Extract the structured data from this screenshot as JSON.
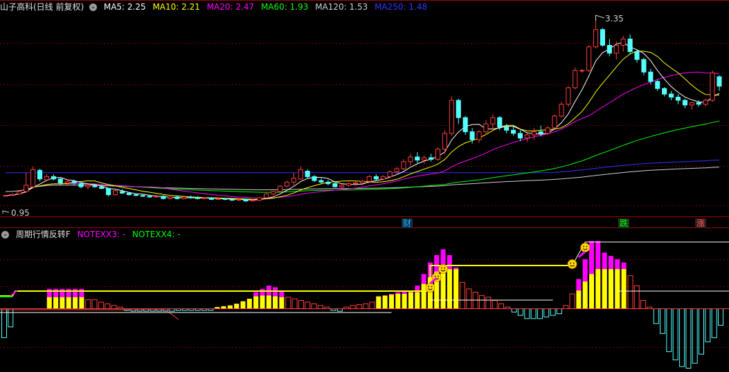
{
  "main_legend": {
    "title": "山子高科(日线 前复权)",
    "items": [
      {
        "label": "MA5: 2.25",
        "color": "#ffffff"
      },
      {
        "label": "MA10: 2.21",
        "color": "#ffff00"
      },
      {
        "label": "MA20: 2.47",
        "color": "#ff00ff"
      },
      {
        "label": "MA60: 1.93",
        "color": "#00ff00"
      },
      {
        "label": "MA120: 1.53",
        "color": "#d0d0d0"
      },
      {
        "label": "MA250: 1.48",
        "color": "#3333ff"
      }
    ]
  },
  "price_labels": {
    "high": "3.35",
    "low": "0.95"
  },
  "event_markers": [
    {
      "label": "财",
      "color": "#00c0ff"
    },
    {
      "label": "跌",
      "color": "#00ff00"
    },
    {
      "label": "涨",
      "color": "#ff6060"
    }
  ],
  "sub_legend": {
    "title": "周期行情反转F",
    "items": [
      {
        "label": "NOTEXX3: -",
        "color": "#ff00ff"
      },
      {
        "label": "NOTEXX4: -",
        "color": "#00ff00"
      }
    ]
  },
  "colors": {
    "up": "#ff3c3c",
    "down": "#54ffff",
    "grid": "#7a0000",
    "magenta_bar": "#ff00ff",
    "yellow_bar": "#ffff00",
    "cyan_bar": "#54ffff",
    "red_bar": "#ff3c3c"
  },
  "chart_data": {
    "type": "candlestick",
    "price_range": [
      0.85,
      3.4
    ],
    "candles": [
      [
        1.09,
        1.1,
        1.08,
        1.09
      ],
      [
        1.1,
        1.12,
        1.09,
        1.1
      ],
      [
        1.11,
        1.15,
        1.1,
        1.14
      ],
      [
        1.14,
        1.38,
        1.12,
        1.22
      ],
      [
        1.2,
        1.46,
        1.18,
        1.42
      ],
      [
        1.41,
        1.43,
        1.27,
        1.3
      ],
      [
        1.29,
        1.36,
        1.27,
        1.33
      ],
      [
        1.33,
        1.36,
        1.28,
        1.3
      ],
      [
        1.3,
        1.31,
        1.22,
        1.25
      ],
      [
        1.25,
        1.29,
        1.21,
        1.27
      ],
      [
        1.27,
        1.29,
        1.23,
        1.25
      ],
      [
        1.24,
        1.26,
        1.18,
        1.2
      ],
      [
        1.2,
        1.23,
        1.17,
        1.22
      ],
      [
        1.21,
        1.24,
        1.19,
        1.2
      ],
      [
        1.2,
        1.22,
        1.17,
        1.18
      ],
      [
        1.18,
        1.19,
        1.08,
        1.1
      ],
      [
        1.1,
        1.16,
        1.09,
        1.15
      ],
      [
        1.14,
        1.17,
        1.11,
        1.12
      ],
      [
        1.12,
        1.13,
        1.09,
        1.1
      ],
      [
        1.1,
        1.12,
        1.08,
        1.09
      ],
      [
        1.09,
        1.11,
        1.07,
        1.08
      ],
      [
        1.08,
        1.1,
        1.06,
        1.07
      ],
      [
        1.07,
        1.1,
        1.06,
        1.08
      ],
      [
        1.08,
        1.09,
        1.04,
        1.05
      ],
      [
        1.05,
        1.08,
        1.04,
        1.07
      ],
      [
        1.07,
        1.09,
        1.04,
        1.05
      ],
      [
        1.05,
        1.08,
        1.04,
        1.07
      ],
      [
        1.07,
        1.09,
        1.05,
        1.06
      ],
      [
        1.06,
        1.08,
        1.04,
        1.05
      ],
      [
        1.05,
        1.07,
        1.04,
        1.06
      ],
      [
        1.06,
        1.07,
        1.03,
        1.04
      ],
      [
        1.04,
        1.06,
        1.03,
        1.05
      ],
      [
        1.05,
        1.06,
        1.03,
        1.04
      ],
      [
        1.04,
        1.05,
        1.02,
        1.03
      ],
      [
        1.03,
        1.05,
        1.02,
        1.04
      ],
      [
        1.04,
        1.05,
        1.01,
        1.02
      ],
      [
        1.02,
        1.04,
        1.01,
        1.03
      ],
      [
        1.03,
        1.07,
        1.02,
        1.06
      ],
      [
        1.06,
        1.12,
        1.05,
        1.11
      ],
      [
        1.11,
        1.15,
        1.09,
        1.14
      ],
      [
        1.14,
        1.22,
        1.13,
        1.21
      ],
      [
        1.21,
        1.28,
        1.19,
        1.26
      ],
      [
        1.26,
        1.38,
        1.22,
        1.31
      ],
      [
        1.3,
        1.46,
        1.29,
        1.42
      ],
      [
        1.4,
        1.42,
        1.3,
        1.33
      ],
      [
        1.33,
        1.35,
        1.26,
        1.28
      ],
      [
        1.28,
        1.31,
        1.24,
        1.26
      ],
      [
        1.26,
        1.29,
        1.22,
        1.24
      ],
      [
        1.24,
        1.27,
        1.19,
        1.2
      ],
      [
        1.2,
        1.24,
        1.17,
        1.22
      ],
      [
        1.22,
        1.26,
        1.2,
        1.24
      ],
      [
        1.24,
        1.28,
        1.21,
        1.25
      ],
      [
        1.25,
        1.29,
        1.22,
        1.27
      ],
      [
        1.27,
        1.35,
        1.25,
        1.33
      ],
      [
        1.33,
        1.36,
        1.28,
        1.3
      ],
      [
        1.3,
        1.35,
        1.28,
        1.33
      ],
      [
        1.33,
        1.41,
        1.31,
        1.39
      ],
      [
        1.39,
        1.45,
        1.35,
        1.43
      ],
      [
        1.43,
        1.55,
        1.41,
        1.52
      ],
      [
        1.52,
        1.62,
        1.47,
        1.58
      ],
      [
        1.58,
        1.64,
        1.5,
        1.54
      ],
      [
        1.54,
        1.6,
        1.49,
        1.57
      ],
      [
        1.57,
        1.62,
        1.52,
        1.55
      ],
      [
        1.55,
        1.7,
        1.53,
        1.68
      ],
      [
        1.68,
        1.92,
        1.62,
        1.88
      ],
      [
        1.88,
        2.35,
        1.85,
        2.3
      ],
      [
        2.3,
        2.32,
        2.0,
        2.08
      ],
      [
        2.08,
        2.1,
        1.86,
        1.9
      ],
      [
        1.9,
        1.95,
        1.75,
        1.8
      ],
      [
        1.8,
        1.92,
        1.76,
        1.9
      ],
      [
        1.9,
        2.05,
        1.86,
        2.0
      ],
      [
        2.0,
        2.12,
        1.92,
        2.08
      ],
      [
        2.08,
        2.1,
        1.92,
        1.96
      ],
      [
        1.96,
        2.0,
        1.88,
        1.92
      ],
      [
        1.92,
        1.98,
        1.85,
        1.88
      ],
      [
        1.88,
        1.92,
        1.78,
        1.82
      ],
      [
        1.82,
        1.88,
        1.77,
        1.86
      ],
      [
        1.86,
        1.95,
        1.8,
        1.9
      ],
      [
        1.9,
        1.98,
        1.84,
        1.88
      ],
      [
        1.88,
        1.97,
        1.86,
        1.95
      ],
      [
        1.95,
        2.12,
        1.94,
        2.1
      ],
      [
        2.1,
        2.28,
        2.08,
        2.25
      ],
      [
        2.25,
        2.48,
        2.22,
        2.46
      ],
      [
        2.46,
        2.72,
        2.44,
        2.68
      ],
      [
        2.68,
        2.7,
        2.65,
        2.68
      ],
      [
        2.68,
        3.0,
        2.66,
        2.98
      ],
      [
        2.98,
        3.35,
        2.96,
        3.2
      ],
      [
        3.2,
        3.22,
        2.98,
        3.0
      ],
      [
        3.0,
        3.08,
        2.86,
        2.9
      ],
      [
        2.9,
        3.05,
        2.82,
        3.0
      ],
      [
        3.0,
        3.12,
        2.92,
        3.08
      ],
      [
        3.08,
        3.14,
        2.88,
        2.92
      ],
      [
        2.92,
        2.94,
        2.78,
        2.82
      ],
      [
        2.82,
        2.84,
        2.62,
        2.66
      ],
      [
        2.66,
        2.7,
        2.5,
        2.54
      ],
      [
        2.54,
        2.56,
        2.42,
        2.45
      ],
      [
        2.45,
        2.47,
        2.35,
        2.38
      ],
      [
        2.38,
        2.42,
        2.3,
        2.34
      ],
      [
        2.34,
        2.38,
        2.25,
        2.3
      ],
      [
        2.3,
        2.32,
        2.2,
        2.24
      ],
      [
        2.24,
        2.28,
        2.18,
        2.27
      ],
      [
        2.27,
        2.3,
        2.22,
        2.25
      ],
      [
        2.25,
        2.32,
        2.22,
        2.3
      ],
      [
        2.3,
        2.68,
        2.28,
        2.65
      ],
      [
        2.6,
        2.62,
        2.42,
        2.48
      ]
    ],
    "indicator": {
      "range": [
        -75,
        85
      ],
      "bars": [
        [
          -35,
          0,
          0
        ],
        [
          -22,
          0,
          0
        ],
        [
          0,
          0,
          0
        ],
        [
          0,
          0,
          0
        ],
        [
          0,
          0,
          0
        ],
        [
          0,
          0,
          0
        ],
        [
          0,
          0,
          0
        ],
        [
          14,
          14,
          24
        ],
        [
          14,
          14,
          24
        ],
        [
          14,
          14,
          24
        ],
        [
          14,
          14,
          24
        ],
        [
          14,
          14,
          24
        ],
        [
          14,
          14,
          24
        ],
        [
          11,
          0,
          0
        ],
        [
          11,
          0,
          0
        ],
        [
          8,
          0,
          0
        ],
        [
          6,
          0,
          0
        ],
        [
          4,
          0,
          0
        ],
        [
          2,
          0,
          0
        ],
        [
          -2,
          0,
          0
        ],
        [
          -3,
          0,
          0
        ],
        [
          -3,
          0,
          0
        ],
        [
          -3,
          0,
          0
        ],
        [
          -3,
          0,
          0
        ],
        [
          -3,
          0,
          0
        ],
        [
          -3,
          0,
          0
        ],
        [
          -3,
          0,
          0
        ],
        [
          -2,
          0,
          0
        ],
        [
          -2,
          0,
          0
        ],
        [
          -2,
          0,
          0
        ],
        [
          -2,
          0,
          0
        ],
        [
          -2,
          0,
          0
        ],
        [
          -2,
          0,
          0
        ],
        [
          2,
          2,
          2
        ],
        [
          3,
          3,
          3
        ],
        [
          4,
          4,
          4
        ],
        [
          6,
          6,
          6
        ],
        [
          9,
          9,
          9
        ],
        [
          12,
          12,
          12
        ],
        [
          15,
          15,
          20
        ],
        [
          16,
          16,
          24
        ],
        [
          16,
          16,
          28
        ],
        [
          15,
          15,
          26
        ],
        [
          14,
          14,
          22
        ],
        [
          14,
          0,
          0
        ],
        [
          12,
          0,
          0
        ],
        [
          10,
          0,
          0
        ],
        [
          8,
          0,
          0
        ],
        [
          6,
          0,
          0
        ],
        [
          4,
          0,
          0
        ],
        [
          2,
          0,
          0
        ],
        [
          -2,
          0,
          0
        ],
        [
          -3,
          0,
          0
        ],
        [
          2,
          0,
          0
        ],
        [
          4,
          0,
          0
        ],
        [
          5,
          0,
          0
        ],
        [
          6,
          0,
          0
        ],
        [
          8,
          0,
          0
        ],
        [
          15,
          15,
          15
        ],
        [
          16,
          16,
          16
        ],
        [
          17,
          17,
          18
        ],
        [
          18,
          18,
          20
        ],
        [
          18,
          18,
          22
        ],
        [
          20,
          20,
          22
        ],
        [
          20,
          20,
          28
        ],
        [
          30,
          30,
          42
        ],
        [
          38,
          38,
          56
        ],
        [
          45,
          45,
          65
        ],
        [
          48,
          48,
          72
        ],
        [
          48,
          48,
          65
        ],
        [
          48,
          48,
          50
        ],
        [
          32,
          0,
          0
        ],
        [
          24,
          0,
          0
        ],
        [
          20,
          0,
          0
        ],
        [
          16,
          0,
          0
        ],
        [
          14,
          0,
          0
        ],
        [
          10,
          0,
          0
        ],
        [
          6,
          0,
          0
        ],
        [
          2,
          0,
          0
        ],
        [
          -4,
          0,
          0
        ],
        [
          -8,
          0,
          0
        ],
        [
          -12,
          0,
          0
        ],
        [
          -12,
          0,
          0
        ],
        [
          -12,
          0,
          0
        ],
        [
          -10,
          0,
          0
        ],
        [
          -8,
          0,
          0
        ],
        [
          -6,
          0,
          0
        ],
        [
          4,
          0,
          0
        ],
        [
          18,
          0,
          0
        ],
        [
          22,
          22,
          36
        ],
        [
          33,
          33,
          60
        ],
        [
          42,
          42,
          82
        ],
        [
          48,
          48,
          82
        ],
        [
          48,
          48,
          68
        ],
        [
          48,
          48,
          64
        ],
        [
          48,
          48,
          60
        ],
        [
          48,
          48,
          56
        ],
        [
          40,
          0,
          0
        ],
        [
          28,
          0,
          0
        ],
        [
          10,
          0,
          0
        ],
        [
          2,
          0,
          0
        ],
        [
          -18,
          0,
          0
        ],
        [
          -30,
          0,
          0
        ],
        [
          -52,
          0,
          0
        ],
        [
          -62,
          0,
          0
        ],
        [
          -70,
          0,
          0
        ],
        [
          -72,
          0,
          0
        ],
        [
          -66,
          0,
          0
        ],
        [
          -55,
          0,
          0
        ],
        [
          -40,
          0,
          0
        ],
        [
          -35,
          0,
          0
        ],
        [
          -20,
          0,
          0
        ]
      ]
    }
  }
}
